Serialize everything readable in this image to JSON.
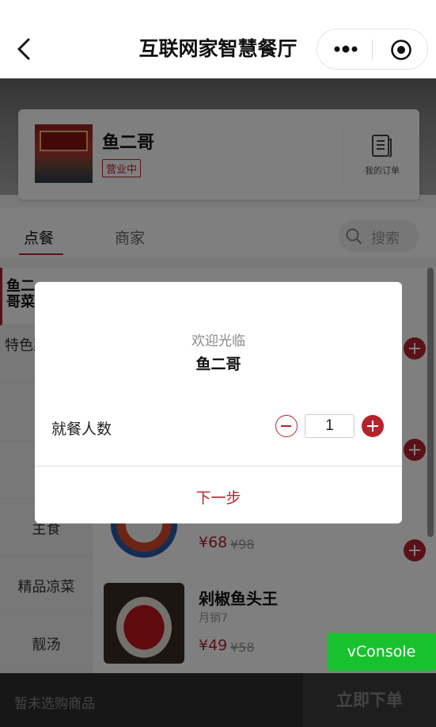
{
  "nav": {
    "title": "互联网家智慧餐厅"
  },
  "shop": {
    "name": "鱼二哥",
    "status": "营业中",
    "orders_label": "我的订单"
  },
  "tabs": [
    {
      "label": "点餐"
    },
    {
      "label": "商家"
    }
  ],
  "search": {
    "placeholder": "搜索"
  },
  "categories": [
    {
      "label": "鱼二哥菜"
    },
    {
      "label": "特色菜"
    },
    {
      "label": ""
    },
    {
      "label": ""
    },
    {
      "label": "主食"
    },
    {
      "label": "精品凉菜"
    },
    {
      "label": "靓汤"
    }
  ],
  "dishes": [
    {
      "name": "",
      "sales": "",
      "price": "¥68",
      "original_price": "¥98"
    },
    {
      "name": "剁椒鱼头王",
      "sales": "月销7",
      "price": "¥49",
      "original_price": "¥58"
    }
  ],
  "cart": {
    "empty_text": "暂未选购商品",
    "submit_label": "立即下单"
  },
  "vconsole": {
    "label": "vConsole"
  },
  "modal": {
    "welcome": "欢迎光临",
    "shop_name": "鱼二哥",
    "party_label": "就餐人数",
    "party_count": "1",
    "next_label": "下一步"
  },
  "colors": {
    "accent": "#b5232d",
    "vconsole": "#17c22e"
  }
}
